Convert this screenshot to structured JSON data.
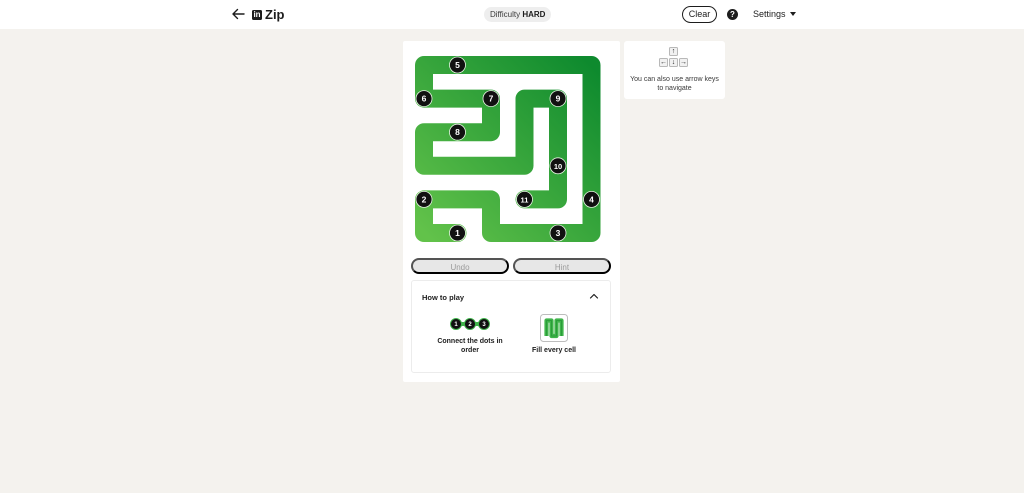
{
  "header": {
    "logo_badge": "in",
    "app_name": "Zip",
    "difficulty_label": "Difficulty",
    "difficulty_value": "HARD",
    "clear_label": "Clear",
    "help_symbol": "?",
    "settings_label": "Settings"
  },
  "board": {
    "rows": 6,
    "cols": 6,
    "path_color_light": "#62c24a",
    "path_color_dark": "#0e8a2e",
    "path": [
      [
        5,
        1
      ],
      [
        5,
        0
      ],
      [
        4,
        0
      ],
      [
        4,
        1
      ],
      [
        4,
        2
      ],
      [
        5,
        2
      ],
      [
        5,
        3
      ],
      [
        5,
        4
      ],
      [
        5,
        5
      ],
      [
        4,
        5
      ],
      [
        3,
        5
      ],
      [
        2,
        5
      ],
      [
        1,
        5
      ],
      [
        0,
        5
      ],
      [
        0,
        4
      ],
      [
        0,
        3
      ],
      [
        0,
        2
      ],
      [
        0,
        1
      ],
      [
        0,
        0
      ],
      [
        1,
        0
      ],
      [
        1,
        1
      ],
      [
        1,
        2
      ],
      [
        2,
        2
      ],
      [
        2,
        1
      ],
      [
        2,
        0
      ],
      [
        3,
        0
      ],
      [
        3,
        1
      ],
      [
        3,
        2
      ],
      [
        3,
        3
      ],
      [
        2,
        3
      ],
      [
        1,
        3
      ],
      [
        1,
        4
      ],
      [
        2,
        4
      ],
      [
        3,
        4
      ],
      [
        4,
        4
      ],
      [
        4,
        3
      ]
    ],
    "dots": [
      {
        "num": "1",
        "row": 5,
        "col": 1
      },
      {
        "num": "2",
        "row": 4,
        "col": 0
      },
      {
        "num": "3",
        "row": 5,
        "col": 4
      },
      {
        "num": "4",
        "row": 4,
        "col": 5
      },
      {
        "num": "5",
        "row": 0,
        "col": 1
      },
      {
        "num": "6",
        "row": 1,
        "col": 0
      },
      {
        "num": "7",
        "row": 1,
        "col": 2
      },
      {
        "num": "8",
        "row": 2,
        "col": 1
      },
      {
        "num": "9",
        "row": 1,
        "col": 4
      },
      {
        "num": "10",
        "row": 3,
        "col": 4
      },
      {
        "num": "11",
        "row": 4,
        "col": 3
      }
    ]
  },
  "controls": {
    "undo_label": "Undo",
    "hint_label": "Hint"
  },
  "how_to_play": {
    "title": "How to play",
    "rule1_dots": [
      "1",
      "2",
      "3"
    ],
    "rule1_text": "Connect the dots in order",
    "rule2_text": "Fill every cell"
  },
  "tip": {
    "keys": {
      "up": "↑",
      "left": "←",
      "down": "↓",
      "right": "→"
    },
    "text": "You can also use arrow keys to navigate"
  }
}
